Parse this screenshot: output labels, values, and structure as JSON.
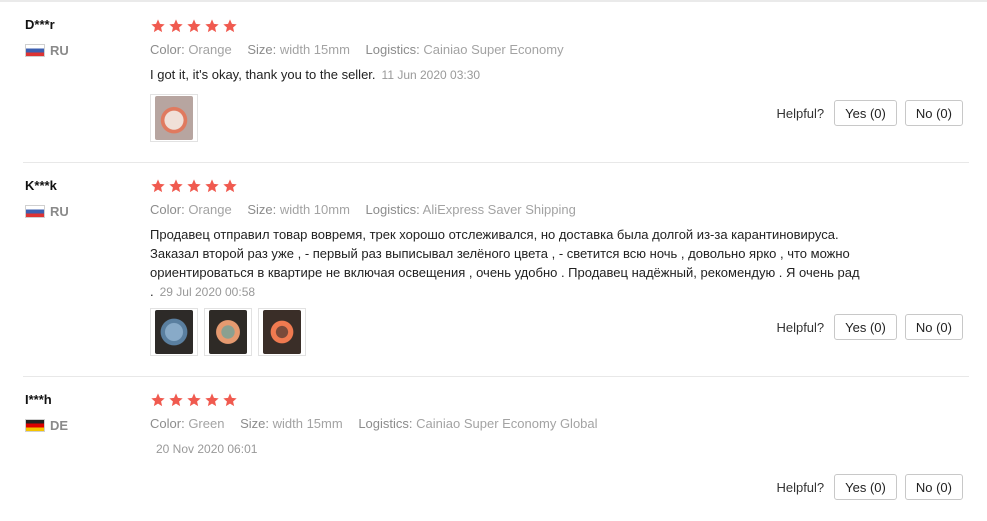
{
  "helpful_label": "Helpful?",
  "reviews": [
    {
      "user": "D***r",
      "country": "RU",
      "flag": "flag-ru",
      "rating": 5,
      "color_key": "Color:",
      "color_val": "Orange",
      "size_key": "Size:",
      "size_val": "width 15mm",
      "logistics_key": "Logistics:",
      "logistics_val": "Cainiao Super Economy",
      "text": "I got it, it's okay, thank you to the seller.",
      "date": "11 Jun 2020 03:30",
      "yes": "Yes (0)",
      "no": "No (0)"
    },
    {
      "user": "K***k",
      "country": "RU",
      "flag": "flag-ru",
      "rating": 5,
      "color_key": "Color:",
      "color_val": "Orange",
      "size_key": "Size:",
      "size_val": "width 10mm",
      "logistics_key": "Logistics:",
      "logistics_val": "AliExpress Saver Shipping",
      "text": "Продавец отправил товар вовремя, трек хорошо отслеживался, но доставка была долгой из-за карантиновируса. Заказал второй раз уже , - первый раз выписывал зелёного цвета , - светится всю ночь , довольно ярко , что можно ориентироваться в квартире не включая освещения , очень удобно . Продавец надёжный, рекомендую . Я очень рад .",
      "date": "29 Jul 2020 00:58",
      "yes": "Yes (0)",
      "no": "No (0)"
    },
    {
      "user": "I***h",
      "country": "DE",
      "flag": "flag-de",
      "rating": 5,
      "color_key": "Color:",
      "color_val": "Green",
      "size_key": "Size:",
      "size_val": "width 15mm",
      "logistics_key": "Logistics:",
      "logistics_val": "Cainiao Super Economy Global",
      "text": "",
      "date": "20 Nov 2020 06:01",
      "yes": "Yes (0)",
      "no": "No (0)"
    }
  ],
  "colors": {
    "star": "#f05a4f",
    "muted": "#999999"
  }
}
